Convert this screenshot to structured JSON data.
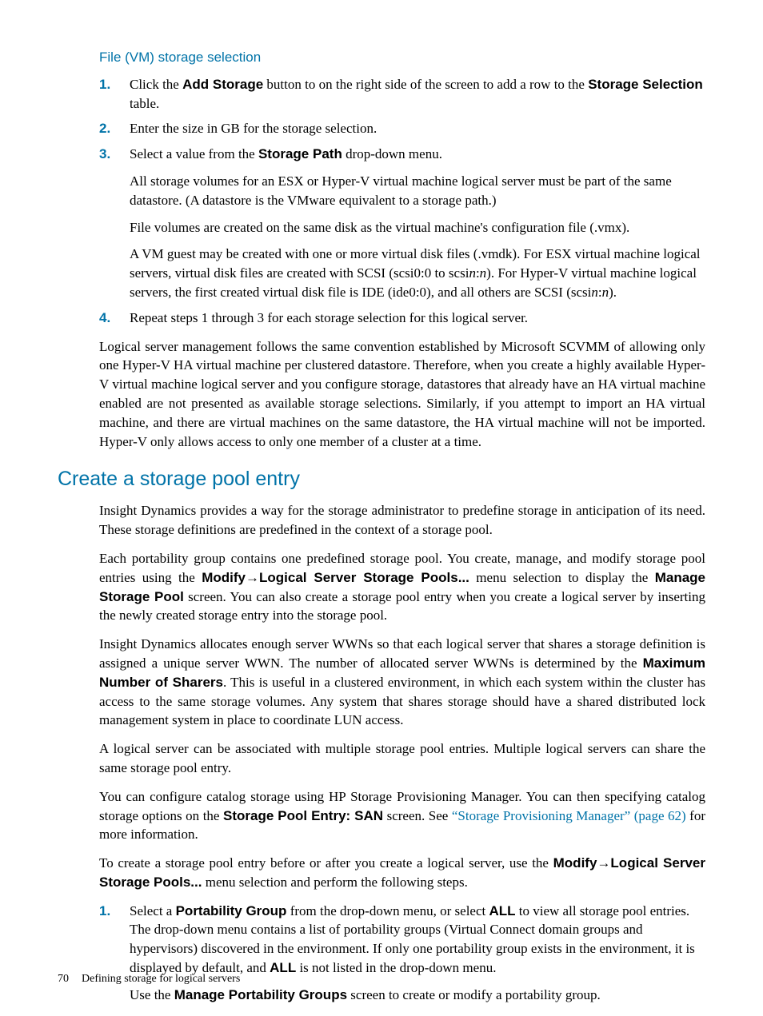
{
  "section1": {
    "title": "File (VM) storage selection",
    "items": [
      {
        "num": "1.",
        "paras": [
          {
            "parts": [
              {
                "t": "Click the "
              },
              {
                "t": "Add Storage",
                "b": true
              },
              {
                "t": " button to on the right side of the screen to add a row to the "
              },
              {
                "t": "Storage Selection",
                "b": true
              },
              {
                "t": " table."
              }
            ]
          }
        ]
      },
      {
        "num": "2.",
        "paras": [
          {
            "parts": [
              {
                "t": "Enter the size in GB for the storage selection."
              }
            ]
          }
        ]
      },
      {
        "num": "3.",
        "paras": [
          {
            "parts": [
              {
                "t": "Select a value from the "
              },
              {
                "t": "Storage Path",
                "b": true
              },
              {
                "t": " drop-down menu."
              }
            ]
          },
          {
            "parts": [
              {
                "t": "All storage volumes for an ESX or Hyper-V virtual machine logical server must be part of the same datastore. (A datastore is the VMware equivalent to a storage path.)"
              }
            ]
          },
          {
            "parts": [
              {
                "t": "File volumes are created on the same disk as the virtual machine's configuration file (.vmx)."
              }
            ]
          },
          {
            "parts": [
              {
                "t": "A VM guest may be created with one or more virtual disk files (.vmdk). For ESX virtual machine logical servers, virtual disk files are created with SCSI (scsi0:0 to scsi"
              },
              {
                "t": "n",
                "i": true
              },
              {
                "t": ":"
              },
              {
                "t": "n",
                "i": true
              },
              {
                "t": "). For Hyper-V virtual machine logical servers, the first created virtual disk file is IDE (ide0:0), and all others are SCSI (scsi"
              },
              {
                "t": "n",
                "i": true
              },
              {
                "t": ":"
              },
              {
                "t": "n",
                "i": true
              },
              {
                "t": ")."
              }
            ]
          }
        ]
      },
      {
        "num": "4.",
        "paras": [
          {
            "parts": [
              {
                "t": "Repeat steps 1 through 3 for each storage selection for this logical server."
              }
            ]
          }
        ]
      }
    ],
    "tail_para": {
      "parts": [
        {
          "t": "Logical server management follows the same convention established by Microsoft SCVMM of allowing only one Hyper-V HA virtual machine per clustered datastore. Therefore, when you create a highly available Hyper-V virtual machine logical server and you configure storage, datastores that already have an HA virtual machine enabled are not presented as available storage selections. Similarly, if you attempt to import an HA virtual machine, and there are virtual machines on the same datastore, the HA virtual machine will not be imported. Hyper-V only allows access to only one member of a cluster at a time."
        }
      ]
    }
  },
  "section2": {
    "title": "Create a storage pool entry",
    "paras": [
      {
        "parts": [
          {
            "t": "Insight Dynamics provides a way for the storage administrator to predefine storage in anticipation of its need. These storage definitions are predefined in the context of a storage pool."
          }
        ]
      },
      {
        "parts": [
          {
            "t": "Each portability group contains one predefined storage pool. You create, manage, and modify storage pool entries using the "
          },
          {
            "t": "Modify",
            "b": true
          },
          {
            "t": "→",
            "arrow": true
          },
          {
            "t": "Logical Server Storage Pools...",
            "b": true
          },
          {
            "t": " menu selection to display the "
          },
          {
            "t": "Manage Storage Pool",
            "b": true
          },
          {
            "t": "  screen. You can also create a storage pool entry when you create a logical server by inserting the newly created storage entry into the storage pool."
          }
        ]
      },
      {
        "parts": [
          {
            "t": "Insight Dynamics allocates enough server WWNs so that each logical server that shares a storage definition is assigned a unique server WWN. The number of allocated server WWNs is determined by the "
          },
          {
            "t": "Maximum Number of Sharers",
            "b": true
          },
          {
            "t": ". This is useful in a clustered environment, in which each system within the cluster has access to the same storage volumes. Any system that shares storage should have a shared distributed lock management system in place to coordinate LUN access."
          }
        ]
      },
      {
        "parts": [
          {
            "t": "A logical server can be associated with multiple storage pool entries. Multiple logical servers can share the same storage pool entry."
          }
        ]
      },
      {
        "parts": [
          {
            "t": "You can configure catalog storage using HP Storage Provisioning Manager. You can then specifying catalog storage options on the "
          },
          {
            "t": "Storage Pool Entry: SAN",
            "b": true
          },
          {
            "t": " screen. See "
          },
          {
            "t": "“Storage Provisioning Manager” (page 62)",
            "link": true
          },
          {
            "t": " for more information."
          }
        ]
      },
      {
        "parts": [
          {
            "t": "To create a storage pool entry before or after you create a logical server, use the "
          },
          {
            "t": "Modify",
            "b": true
          },
          {
            "t": "→",
            "arrow": true
          },
          {
            "t": "Logical Server Storage Pools...",
            "b": true
          },
          {
            "t": " menu selection and perform the following steps."
          }
        ]
      }
    ],
    "items": [
      {
        "num": "1.",
        "paras": [
          {
            "parts": [
              {
                "t": "Select a "
              },
              {
                "t": "Portability Group",
                "b": true
              },
              {
                "t": " from the drop-down menu, or select "
              },
              {
                "t": "ALL",
                "b": true
              },
              {
                "t": " to view all storage pool entries. The drop-down menu contains a list of portability groups (Virtual Connect domain groups and hypervisors) discovered in the environment. If only one portability group exists in the environment, it is displayed by default, and "
              },
              {
                "t": "ALL",
                "b": true
              },
              {
                "t": " is not listed in the drop-down menu."
              }
            ]
          },
          {
            "parts": [
              {
                "t": "Use the "
              },
              {
                "t": "Manage Portability Groups",
                "b": true
              },
              {
                "t": " screen to create or modify a portability group."
              }
            ]
          }
        ]
      }
    ]
  },
  "footer": {
    "page": "70",
    "text": "Defining storage for logical servers"
  }
}
